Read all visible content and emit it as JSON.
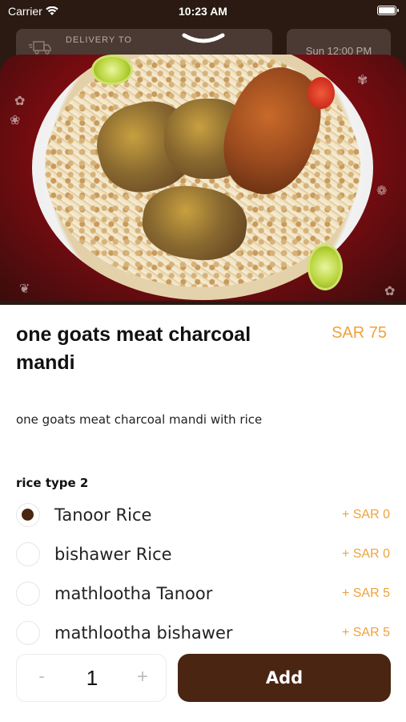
{
  "status_bar": {
    "carrier": "Carrier",
    "time": "10:23 AM"
  },
  "header": {
    "delivery_label": "DELIVERY TO",
    "schedule": "Sun 12:00 PM"
  },
  "item": {
    "title": "one goats meat charcoal mandi",
    "price": "SAR 75",
    "description": "one goats meat  charcoal mandi with rice"
  },
  "options_section": {
    "title": "rice type 2",
    "options": [
      {
        "label": "Tanoor Rice",
        "price": "+ SAR 0",
        "selected": true
      },
      {
        "label": "bishawer Rice",
        "price": "+ SAR 0",
        "selected": false
      },
      {
        "label": "mathlootha Tanoor",
        "price": "+ SAR 5",
        "selected": false
      },
      {
        "label": "mathlootha bishawer",
        "price": "+ SAR 5",
        "selected": false
      }
    ]
  },
  "bottom_bar": {
    "minus": "-",
    "quantity": "1",
    "plus": "+",
    "add_label": "Add"
  },
  "colors": {
    "accent": "#f0a23a",
    "primary": "#4a2512",
    "hero_background": "#8a0c12"
  },
  "icons": [
    "wifi-icon",
    "battery-icon",
    "delivery-truck-icon",
    "chevron-down-icon"
  ]
}
